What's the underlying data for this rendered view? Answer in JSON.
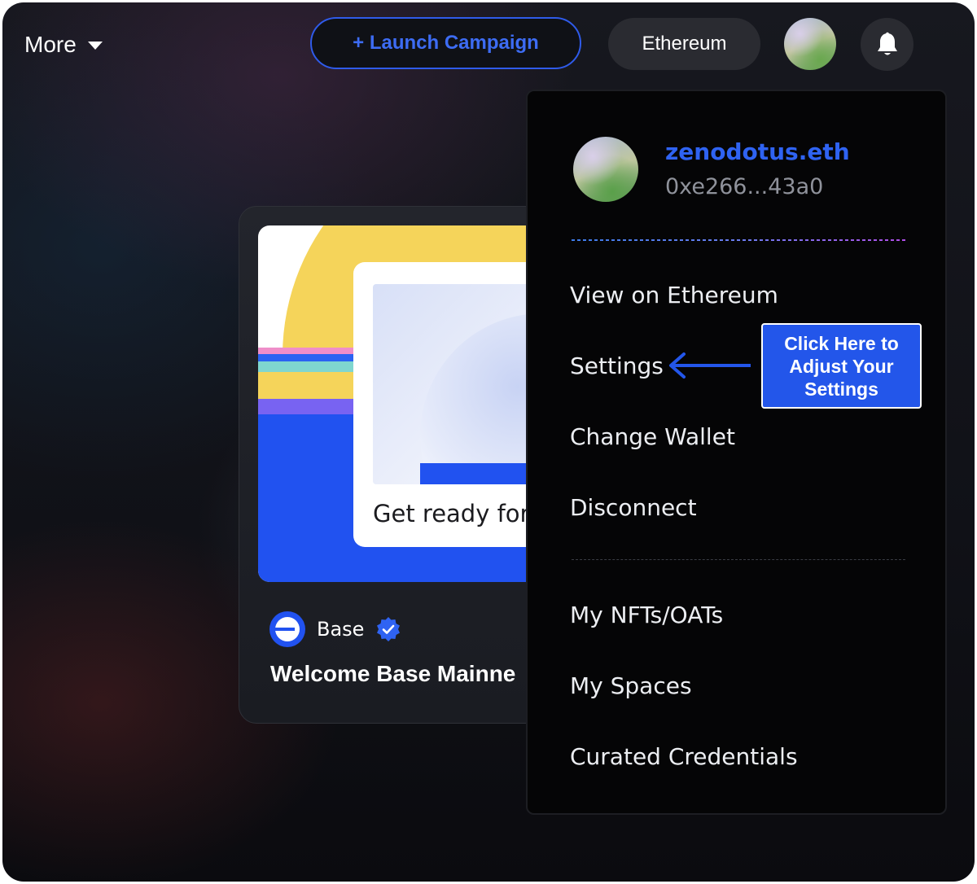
{
  "topbar": {
    "more_label": "More",
    "launch_label": "+ Launch Campaign",
    "network_label": "Ethereum"
  },
  "card": {
    "banner_caption": "Get ready for",
    "space_name": "Base",
    "title": "Welcome Base Mainne"
  },
  "menu": {
    "ens_name": "zenodotus.eth",
    "address": "0xe266...43a0",
    "items": [
      {
        "label": "View on Ethereum"
      },
      {
        "label": "Settings"
      },
      {
        "label": "Change Wallet"
      },
      {
        "label": "Disconnect"
      },
      {
        "label": "My NFTs/OATs"
      },
      {
        "label": "My Spaces"
      },
      {
        "label": "Curated Credentials"
      }
    ]
  },
  "callout": {
    "text": "Click Here to Adjust Your Settings"
  },
  "colors": {
    "accent": "#2f63f2",
    "callout_bg": "#2356ea",
    "menu_bg": "#050506",
    "pill_bg": "#2a2b31"
  },
  "icons": {
    "more": "chevron-down-icon",
    "bell": "bell-icon",
    "verified": "verified-badge-icon",
    "arrow": "arrow-left-icon"
  }
}
